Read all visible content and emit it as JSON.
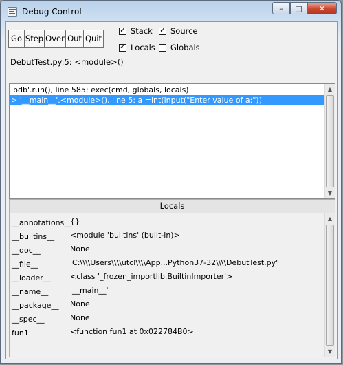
{
  "window": {
    "title": "Debug Control"
  },
  "titlebar": {
    "minimize": "–",
    "maximize": "□",
    "close": "✕"
  },
  "toolbar": {
    "buttons": [
      "Go",
      "Step",
      "Over",
      "Out",
      "Quit"
    ],
    "checkboxes": [
      {
        "label": "Stack",
        "checked": true
      },
      {
        "label": "Source",
        "checked": true
      },
      {
        "label": "Locals",
        "checked": true
      },
      {
        "label": "Globals",
        "checked": false
      }
    ]
  },
  "location": "DebutTest.py:5: <module>()",
  "stack": [
    "'bdb'.run(), line 585: exec(cmd, globals, locals)",
    "> '__main__'.<module>(), line 5: a =int(input(\"Enter value of a:\"))"
  ],
  "locals": {
    "header": "Locals",
    "rows": [
      {
        "name": "__annotations__",
        "value": "{}"
      },
      {
        "name": "__builtins__",
        "value": "<module 'builtins' (built-in)>"
      },
      {
        "name": "__doc__",
        "value": "None"
      },
      {
        "name": "__file__",
        "value": "'C:\\\\\\\\Users\\\\\\\\utcl\\\\\\\\App...Python37-32\\\\\\\\DebutTest.py'"
      },
      {
        "name": "__loader__",
        "value": "<class '_frozen_importlib.BuiltinImporter'>"
      },
      {
        "name": "__name__",
        "value": "'__main__'"
      },
      {
        "name": "__package__",
        "value": "None"
      },
      {
        "name": "__spec__",
        "value": "None"
      },
      {
        "name": "fun1",
        "value": "<function fun1 at 0x022784B0>"
      }
    ]
  },
  "colors": {
    "selection": "#3399ff",
    "close_button": "#c9472f"
  }
}
